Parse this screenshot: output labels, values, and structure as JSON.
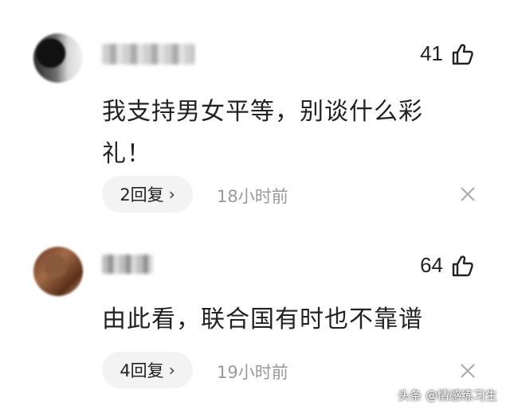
{
  "comments": [
    {
      "likes": "41",
      "text": "我支持男女平等，别谈什么彩礼！",
      "reply_label": "2回复",
      "time": "18小时前"
    },
    {
      "likes": "64",
      "text": "由此看，联合国有时也不靠谱",
      "reply_label": "4回复",
      "time": "19小时前"
    }
  ],
  "icons": {
    "like": "thumbs-up-icon",
    "close": "close-icon",
    "chevron": "chevron-right-icon"
  },
  "watermark": "头条 @情感练习生"
}
